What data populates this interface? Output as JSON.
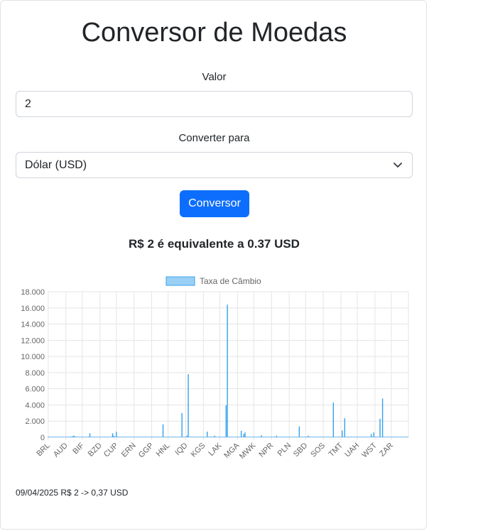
{
  "title": "Conversor de Moedas",
  "form": {
    "amount_label": "Valor",
    "amount_value": "2",
    "target_label": "Converter para",
    "target_selected": "Dólar (USD)",
    "convert_button": "Conversor"
  },
  "result_text": "R$ 2 é equivalente a 0.37 USD",
  "history_entry": "09/04/2025  R$ 2 -> 0,37 USD",
  "chart_data": {
    "type": "bar",
    "legend": [
      "Taxa de Câmbio"
    ],
    "legend_position": "top-center",
    "grid": true,
    "ylim": [
      0,
      18000
    ],
    "y_ticks": [
      "0",
      "2.000",
      "4.000",
      "6.000",
      "8.000",
      "10.000",
      "12.000",
      "14.000",
      "16.000",
      "18.000"
    ],
    "x_tick_labels": [
      "BRL",
      "AUD",
      "BIF",
      "BZD",
      "CUP",
      "ERN",
      "GGP",
      "HNL",
      "IQD",
      "KGS",
      "LAK",
      "MGA",
      "MWK",
      "NPR",
      "PLN",
      "SBD",
      "SOS",
      "TMT",
      "UAH",
      "WST",
      "ZAR"
    ],
    "bar_color": "#36a2eb",
    "series": [
      {
        "name": "Taxa de Câmbio",
        "values": [
          1,
          0,
          0,
          0,
          0,
          0,
          0,
          0,
          0,
          0,
          0,
          0,
          0,
          0,
          0,
          0,
          0,
          0,
          100,
          100,
          200,
          150,
          0,
          0,
          0,
          0,
          0,
          0,
          0,
          0,
          0,
          20,
          0,
          500,
          0,
          0,
          10,
          0,
          0,
          0,
          0,
          0,
          0,
          0,
          0,
          0,
          0,
          0,
          0,
          10,
          0,
          500,
          200,
          0,
          700,
          0,
          0,
          0,
          0,
          0,
          0,
          0,
          0,
          0,
          0,
          0,
          0,
          0,
          0,
          0,
          0,
          0,
          0,
          0,
          0,
          0,
          0,
          0,
          0,
          0,
          0,
          0,
          0,
          0,
          0,
          0,
          10,
          0,
          0,
          0,
          0,
          1600,
          50,
          0,
          0,
          0,
          0,
          0,
          0,
          0,
          0,
          0,
          0,
          0,
          0,
          0,
          3000,
          0,
          0,
          0,
          200,
          7800,
          0,
          0,
          0,
          0,
          0,
          0,
          0,
          0,
          0,
          0,
          0,
          0,
          0,
          0,
          700,
          0,
          0,
          100,
          0,
          0,
          200,
          0,
          0,
          0,
          0,
          0,
          0,
          0,
          0,
          3950,
          16400,
          0,
          0,
          0,
          0,
          0,
          0,
          0,
          0,
          0,
          0,
          800,
          0,
          400,
          600,
          0,
          0,
          0,
          0,
          0,
          0,
          0,
          0,
          0,
          0,
          0,
          0,
          250,
          0,
          0,
          0,
          0,
          0,
          0,
          0,
          0,
          0,
          0,
          0,
          200,
          0,
          0,
          0,
          0,
          0,
          0,
          0,
          0,
          0,
          0,
          0,
          0,
          0,
          0,
          0,
          0,
          0,
          1350,
          0,
          0,
          0,
          0,
          0,
          0,
          200,
          0,
          0,
          0,
          0,
          0,
          0,
          0,
          0,
          0,
          0,
          0,
          0,
          0,
          0,
          0,
          0,
          0,
          0,
          0,
          4300,
          0,
          0,
          0,
          0,
          0,
          0,
          850,
          0,
          2350,
          0,
          0,
          0,
          0,
          0,
          0,
          0,
          0,
          0,
          0,
          0,
          0,
          0,
          0,
          0,
          0,
          0,
          0,
          0,
          0,
          400,
          0,
          600,
          0,
          0,
          0,
          0,
          2300,
          0,
          4800,
          0,
          0,
          0,
          0,
          0,
          0,
          0,
          0,
          0,
          0,
          0,
          0,
          0,
          0,
          0,
          0,
          0,
          0,
          0,
          10
        ]
      }
    ]
  }
}
